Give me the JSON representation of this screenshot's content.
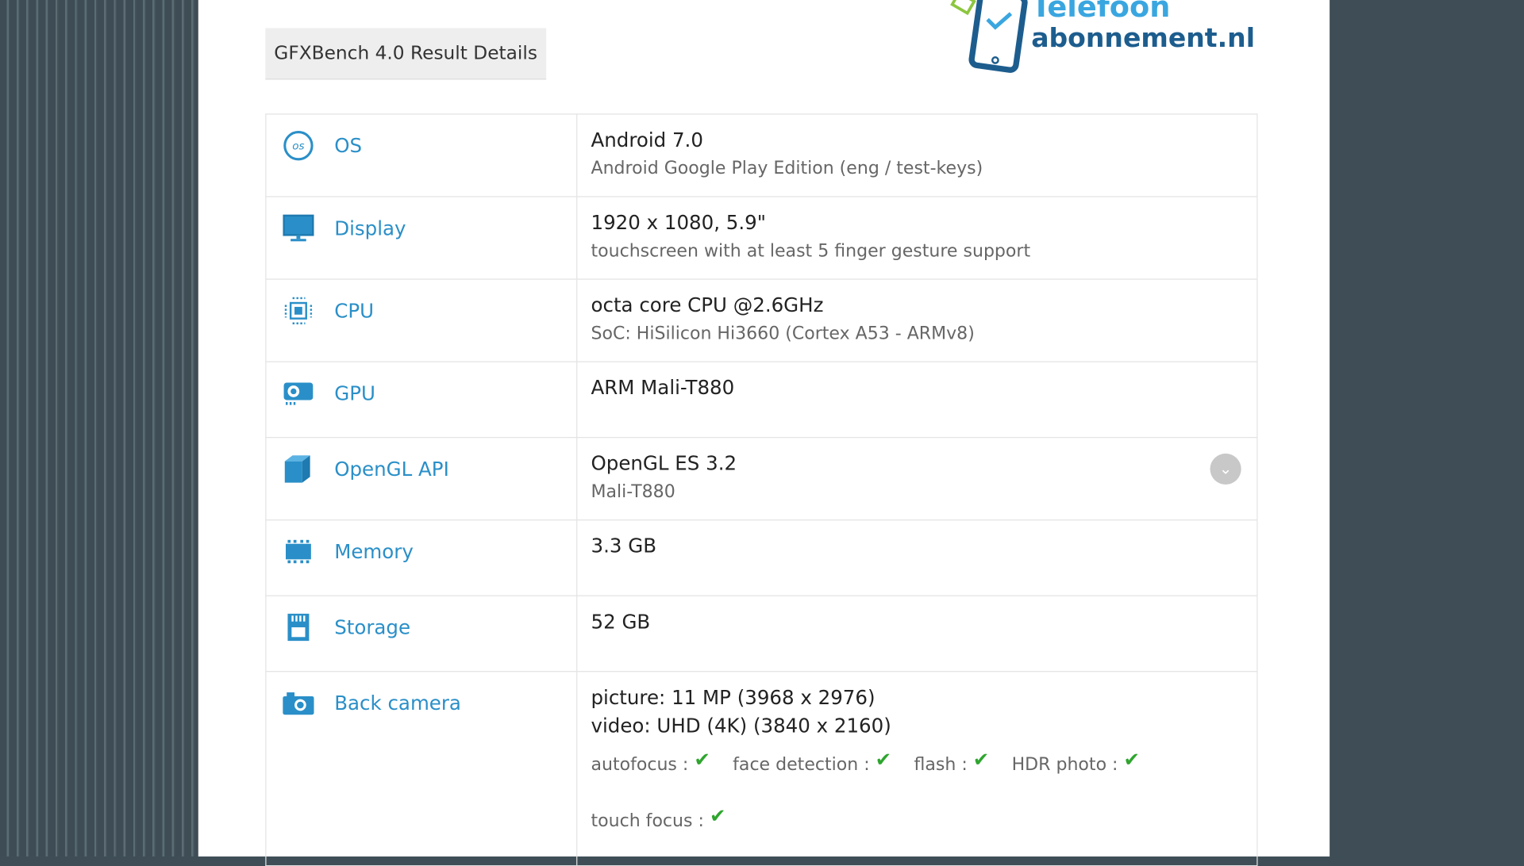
{
  "header": {
    "title": "GFXBench 4.0 Result Details"
  },
  "logo": {
    "line1": "Telefoon",
    "line2": "abonnement.nl"
  },
  "colors": {
    "accent": "#2a8fc8",
    "check": "#2ea52e",
    "background": "#3f4e56"
  },
  "rows": [
    {
      "label": "OS",
      "icon": "os-icon",
      "main": "Android 7.0",
      "sub": "Android Google Play Edition (eng / test-keys)"
    },
    {
      "label": "Display",
      "icon": "monitor-icon",
      "main": "1920 x 1080, 5.9\"",
      "sub": "touchscreen with at least 5 finger gesture support"
    },
    {
      "label": "CPU",
      "icon": "chip-icon",
      "main": "octa core CPU @2.6GHz",
      "sub": "SoC: HiSilicon Hi3660 (Cortex A53 - ARMv8)"
    },
    {
      "label": "GPU",
      "icon": "gpu-icon",
      "main": "ARM Mali-T880"
    },
    {
      "label": "OpenGL API",
      "icon": "cube-icon",
      "main": "OpenGL ES 3.2",
      "sub": "Mali-T880"
    },
    {
      "label": "Memory",
      "icon": "memory-icon",
      "main": "3.3 GB"
    },
    {
      "label": "Storage",
      "icon": "sd-card-icon",
      "main": "52 GB"
    },
    {
      "label": "Back camera",
      "icon": "camera-icon",
      "main": "picture: 11 MP (3968 x 2976)",
      "main2": "video: UHD (4K) (3840 x 2160)",
      "features": [
        "autofocus :",
        "face detection :",
        "flash :",
        "HDR photo :",
        "touch focus :"
      ]
    }
  ]
}
